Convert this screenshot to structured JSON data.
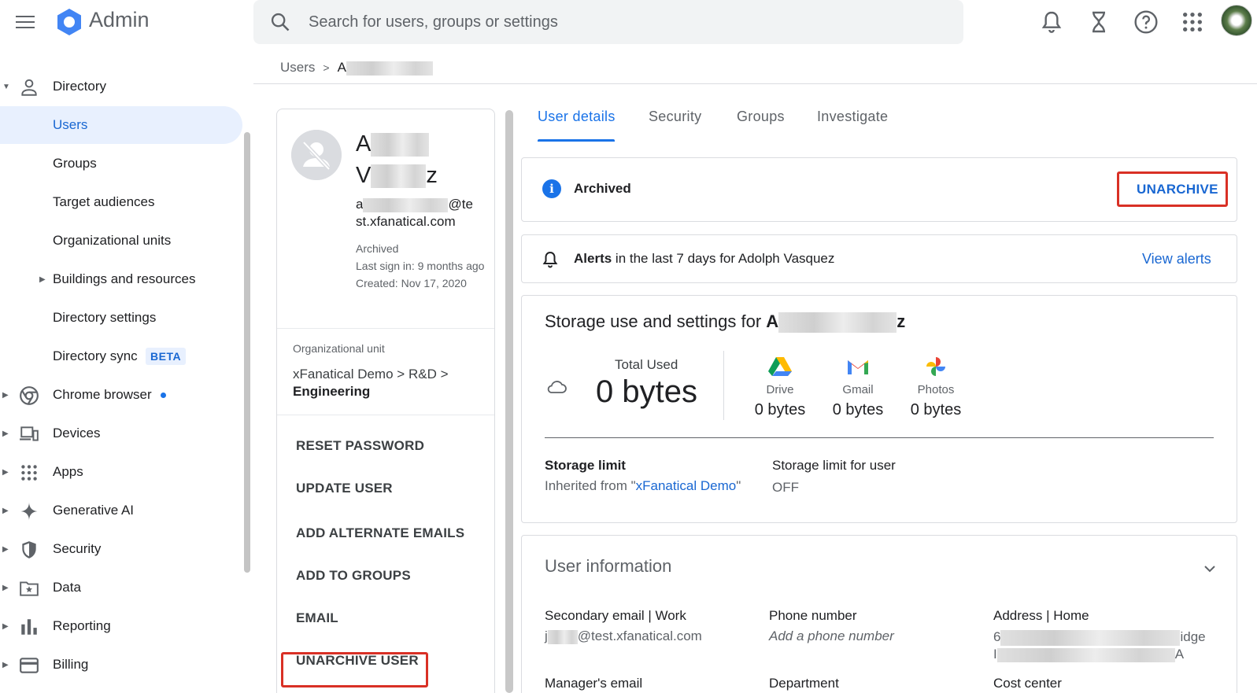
{
  "header": {
    "app_title": "Admin",
    "search_placeholder": "Search for users, groups or settings",
    "icons": [
      "menu-icon",
      "notifications-icon",
      "hourglass-icon",
      "help-icon",
      "apps-grid-icon",
      "account-avatar"
    ]
  },
  "sidebar": {
    "items": [
      {
        "label": "Directory",
        "icon": "person-icon",
        "expanded": true
      },
      {
        "label": "Users",
        "active": true
      },
      {
        "label": "Groups"
      },
      {
        "label": "Target audiences"
      },
      {
        "label": "Organizational units"
      },
      {
        "label": "Buildings and resources",
        "has_children": true
      },
      {
        "label": "Directory settings"
      },
      {
        "label": "Directory sync",
        "badge": "BETA"
      },
      {
        "label": "Chrome browser",
        "icon": "chrome-icon",
        "has_dot": true
      },
      {
        "label": "Devices",
        "icon": "devices-icon"
      },
      {
        "label": "Apps",
        "icon": "apps-icon"
      },
      {
        "label": "Generative AI",
        "icon": "sparkle-icon"
      },
      {
        "label": "Security",
        "icon": "shield-icon"
      },
      {
        "label": "Data",
        "icon": "data-folder-icon"
      },
      {
        "label": "Reporting",
        "icon": "bar-chart-icon"
      },
      {
        "label": "Billing",
        "icon": "credit-card-icon"
      }
    ]
  },
  "breadcrumb": {
    "root": "Users",
    "separator": ">",
    "current_visible": "A"
  },
  "profile": {
    "name_line1_visible": "A",
    "name_line2_visible_start": "V",
    "name_line2_visible_end": "z",
    "email_visible_start": "a",
    "email_visible_end": "@te",
    "email_line2": "st.xfanatical.com",
    "status": "Archived",
    "last_sign_in": "Last sign in: 9 months ago",
    "created": "Created: Nov 17, 2020",
    "org_unit_label": "Organizational unit",
    "org_unit_path_1": "xFanatical Demo",
    "org_unit_path_2": "R&D",
    "org_unit_path_3": "Engineering",
    "path_sep": ">",
    "actions": [
      "RESET PASSWORD",
      "UPDATE USER",
      "ADD ALTERNATE EMAILS",
      "ADD TO GROUPS",
      "EMAIL",
      "UNARCHIVE USER"
    ]
  },
  "tabs": [
    "User details",
    "Security",
    "Groups",
    "Investigate"
  ],
  "archived_card": {
    "status": "Archived",
    "action": "UNARCHIVE"
  },
  "alerts_card": {
    "prefix_bold": "Alerts",
    "text": " in the last 7 days for Adolph Vasquez",
    "link": "View alerts"
  },
  "storage": {
    "title_prefix": "Storage use and settings for ",
    "title_name_start": "A",
    "title_name_end": "z",
    "total_label": "Total Used",
    "total_value": "0 bytes",
    "services": [
      {
        "name": "Drive",
        "value": "0 bytes",
        "icon": "drive-icon"
      },
      {
        "name": "Gmail",
        "value": "0 bytes",
        "icon": "gmail-icon"
      },
      {
        "name": "Photos",
        "value": "0 bytes",
        "icon": "photos-icon"
      }
    ],
    "limit_label": "Storage limit",
    "limit_inherited_prefix": "Inherited from \"",
    "limit_inherited_link": "xFanatical Demo",
    "limit_inherited_suffix": "\"",
    "user_limit_label": "Storage limit for user",
    "user_limit_value": "OFF"
  },
  "user_info": {
    "title": "User information",
    "fields": [
      {
        "label": "Secondary email | Work",
        "value_visible_start": "j",
        "value_visible_end": "@test.xfanatical.com"
      },
      {
        "label": "Phone number",
        "value": "Add a phone number"
      },
      {
        "label": "Address | Home",
        "value_visible_start": "6",
        "value_visible_end": "idge",
        "value_line2_start": "I",
        "value_line2_end": "A"
      },
      {
        "label": "Manager's email"
      },
      {
        "label": "Department"
      },
      {
        "label": "Cost center"
      }
    ]
  },
  "colors": {
    "accent": "#1a73e8",
    "link": "#1967d2",
    "highlight_box": "#d93025",
    "active_nav_bg": "#e8f0fe"
  }
}
